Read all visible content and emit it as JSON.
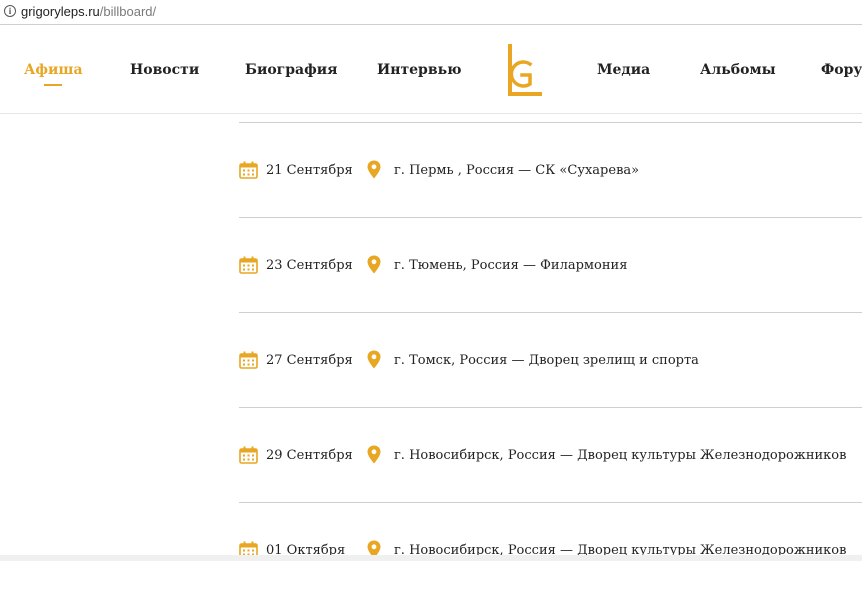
{
  "browser": {
    "url_host": "grigoryleps.ru",
    "url_path": "/billboard/"
  },
  "nav": {
    "items": [
      {
        "label": "Афиша",
        "active": true
      },
      {
        "label": "Новости"
      },
      {
        "label": "Биография"
      },
      {
        "label": "Интервью"
      },
      {
        "label": "Медиа"
      },
      {
        "label": "Альбомы"
      },
      {
        "label": "Форум"
      }
    ],
    "logo_text": "GL"
  },
  "events": [
    {
      "date": "21 Сентября",
      "place": "г. Пермь , Россия — СК «Сухарева»"
    },
    {
      "date": "23 Сентября",
      "place": "г. Тюмень, Россия — Филармония"
    },
    {
      "date": "27 Сентября",
      "place": "г. Томск, Россия — Дворец зрелищ и спорта"
    },
    {
      "date": "29 Сентября",
      "place": "г. Новосибирск, Россия — Дворец культуры Железнодорожников"
    },
    {
      "date": "01 Октября",
      "place": "г. Новосибирск, Россия — Дворец культуры Железнодорожников"
    }
  ],
  "colors": {
    "accent": "#e8a623",
    "text": "#222222",
    "separator": "#cfcfcf"
  },
  "icons": {
    "calendar": "calendar-icon",
    "location": "location-pin-icon",
    "info": "info-icon"
  }
}
